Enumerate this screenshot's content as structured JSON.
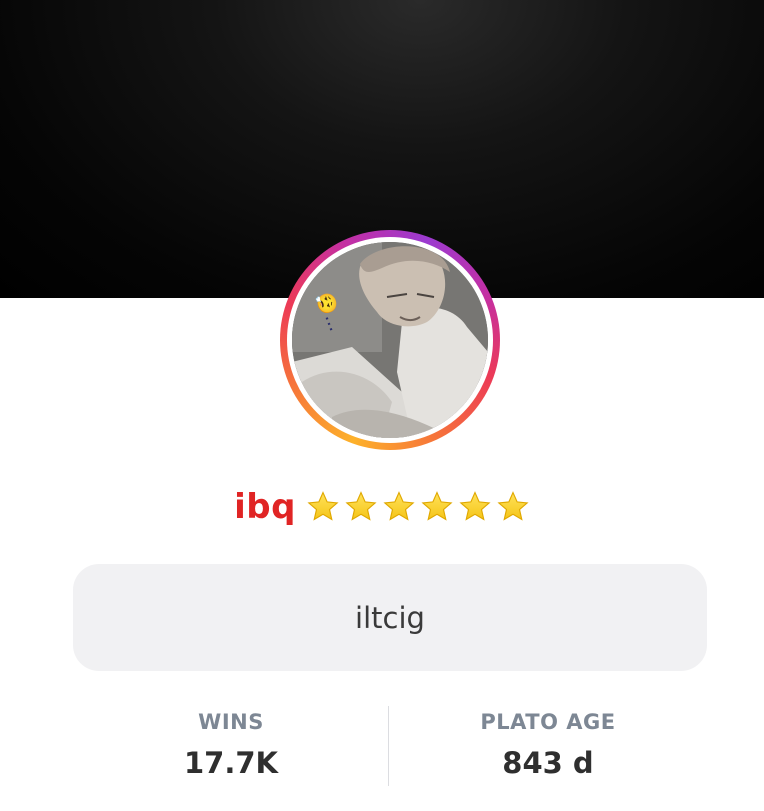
{
  "profile": {
    "username": "ibq",
    "star_count": 6,
    "username_color": "#e02424",
    "bio": "iltcig"
  },
  "stats": {
    "wins_label": "WINS",
    "wins_value": "17.7K",
    "age_label": "PLATO AGE",
    "age_value": "843 d"
  },
  "colors": {
    "ring_start": "#fdb12a",
    "ring_end": "#9b3ad0",
    "star": "#f5c518"
  },
  "avatar": {
    "caption": "😮‍💨..."
  }
}
